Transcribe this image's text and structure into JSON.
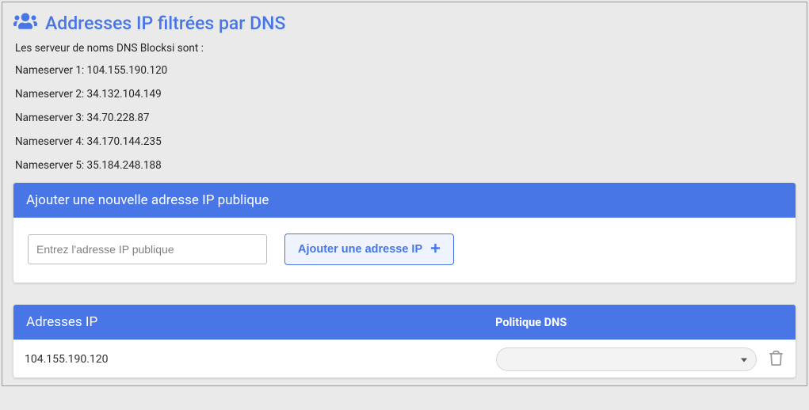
{
  "header": {
    "title": "Addresses IP filtrées par DNS",
    "icon": "users-icon"
  },
  "intro": "Les serveur de noms DNS Blocksi sont :",
  "nameservers": [
    {
      "label": "Nameserver 1:",
      "ip": "104.155.190.120"
    },
    {
      "label": "Nameserver 2:",
      "ip": "34.132.104.149"
    },
    {
      "label": "Nameserver 3:",
      "ip": "34.70.228.87"
    },
    {
      "label": "Nameserver 4:",
      "ip": "34.170.144.235"
    },
    {
      "label": "Nameserver 5:",
      "ip": "35.184.248.188"
    }
  ],
  "add_card": {
    "title": "Ajouter une nouvelle adresse IP publique",
    "placeholder": "Entrez l'adresse IP publique",
    "button": "Ajouter une adresse IP"
  },
  "table": {
    "col_ip": "Adresses IP",
    "col_policy": "Politique DNS",
    "rows": [
      {
        "ip": "104.155.190.120",
        "policy": ""
      }
    ]
  }
}
